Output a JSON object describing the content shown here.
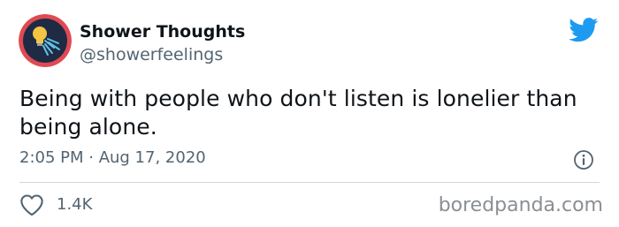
{
  "tweet": {
    "display_name": "Shower Thoughts",
    "handle": "@showerfeelings",
    "text": "Being with people who don't listen is lonelier than being alone.",
    "timestamp": "2:05 PM · Aug 17, 2020",
    "like_count": "1.4K"
  },
  "watermark": "boredpanda.com",
  "icons": {
    "avatar": "lightbulb-shower-avatar",
    "brand": "twitter-bird-icon",
    "info": "info-icon",
    "like": "heart-icon"
  },
  "colors": {
    "twitter_blue": "#1d9bf0",
    "avatar_red": "#e14a52",
    "avatar_navy": "#1f2b45",
    "secondary_text": "#536471"
  }
}
